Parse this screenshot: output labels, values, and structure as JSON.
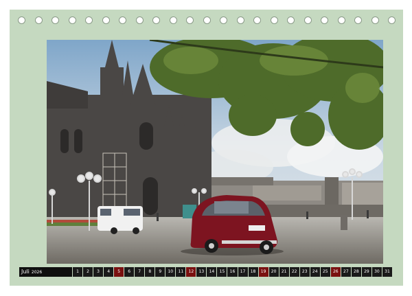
{
  "calendar": {
    "month": "Juli",
    "year": "2026",
    "days": [
      {
        "n": "1"
      },
      {
        "n": "2"
      },
      {
        "n": "3"
      },
      {
        "n": "4"
      },
      {
        "n": "5",
        "red": true
      },
      {
        "n": "6"
      },
      {
        "n": "7"
      },
      {
        "n": "8"
      },
      {
        "n": "9"
      },
      {
        "n": "10"
      },
      {
        "n": "11"
      },
      {
        "n": "12",
        "red": true
      },
      {
        "n": "13"
      },
      {
        "n": "14"
      },
      {
        "n": "15"
      },
      {
        "n": "16"
      },
      {
        "n": "17"
      },
      {
        "n": "18"
      },
      {
        "n": "19",
        "red": true
      },
      {
        "n": "20"
      },
      {
        "n": "21"
      },
      {
        "n": "22"
      },
      {
        "n": "23"
      },
      {
        "n": "24"
      },
      {
        "n": "25"
      },
      {
        "n": "26",
        "red": true
      },
      {
        "n": "27"
      },
      {
        "n": "28"
      },
      {
        "n": "29"
      },
      {
        "n": "30"
      },
      {
        "n": "31"
      }
    ]
  },
  "colors": {
    "page_background": "#c5d9c0",
    "weekday_cell": "#1a1a1a",
    "sunday_cell": "#7a1111",
    "car": "#7d1420"
  },
  "photo_subject": "cathedral-square-with-red-car"
}
